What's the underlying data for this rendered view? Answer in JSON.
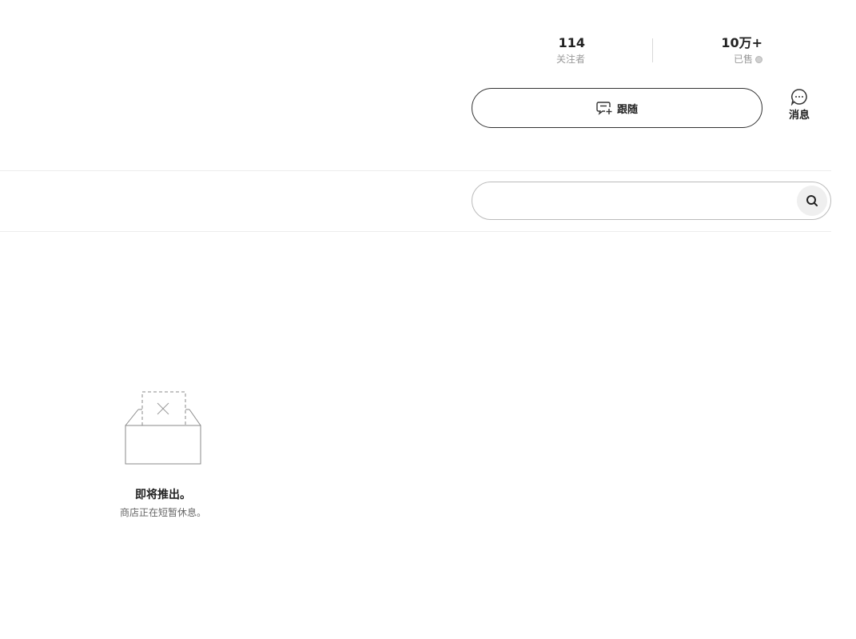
{
  "stats": {
    "followers": {
      "value": "114",
      "label": "关注者"
    },
    "sold": {
      "value": "10万+",
      "label": "已售"
    }
  },
  "actions": {
    "follow_label": "跟随",
    "message_label": "消息"
  },
  "search": {
    "placeholder": "",
    "value": ""
  },
  "empty_state": {
    "title": "即将推出。",
    "subtitle": "商店正在短暂休息。"
  },
  "icons": {
    "follow": "follow-add-icon",
    "message": "chat-bubble-icon",
    "search": "search-icon",
    "info": "info-icon",
    "empty": "empty-box-icon"
  }
}
